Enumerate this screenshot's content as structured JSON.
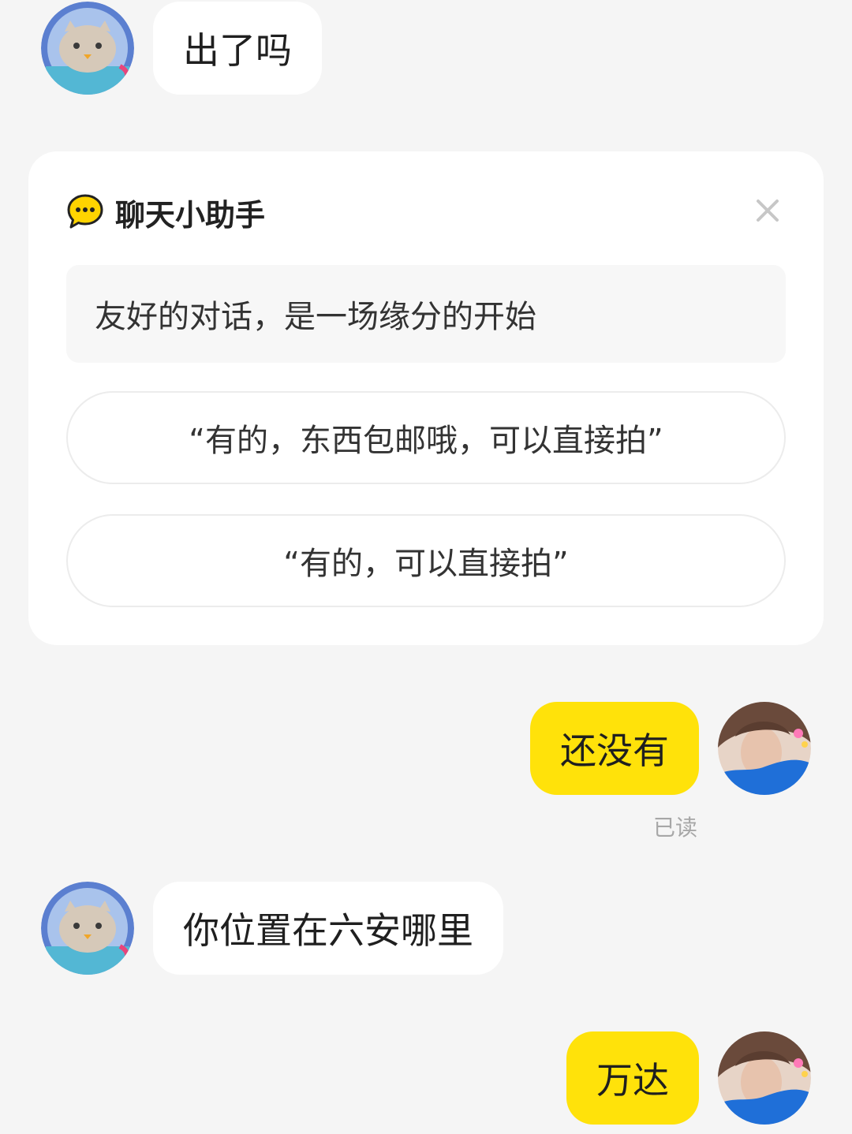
{
  "messages": [
    {
      "side": "in",
      "text": "出了吗"
    },
    {
      "side": "out",
      "text": "还没有",
      "status": "已读"
    },
    {
      "side": "in",
      "text": "你位置在六安哪里"
    },
    {
      "side": "out",
      "text": "万达"
    }
  ],
  "assistant": {
    "icon": "chat-bubble-icon",
    "title": "聊天小助手",
    "close_icon": "close-icon",
    "hint": "友好的对话，是一场缘分的开始",
    "suggestions": [
      "“有的，东西包邮哦，可以直接拍”",
      "“有的，可以直接拍”"
    ]
  },
  "colors": {
    "background": "#f5f5f5",
    "incoming_bubble": "#ffffff",
    "outgoing_bubble": "#ffe20a",
    "read_status": "#a7a7a7",
    "assistant_icon": "#ffd400"
  }
}
